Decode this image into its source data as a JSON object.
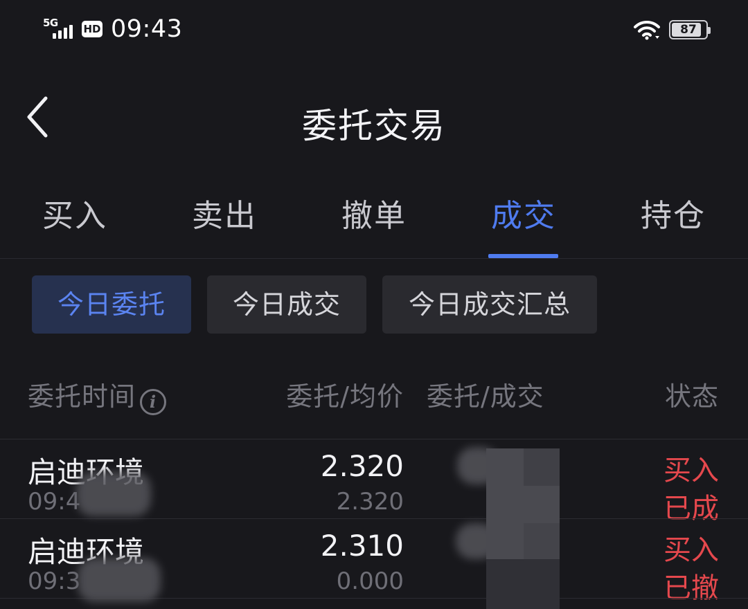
{
  "status_bar": {
    "network": "5G",
    "hd": "HD",
    "time": "09:43",
    "battery": "87",
    "battery_level": 0.87,
    "wifi_icon": "wifi-icon",
    "signal_icon": "signal-icon"
  },
  "header": {
    "title": "委托交易",
    "back_icon": "chevron-left-icon"
  },
  "main_tabs": [
    {
      "label": "买入",
      "active": false
    },
    {
      "label": "卖出",
      "active": false
    },
    {
      "label": "撤单",
      "active": false
    },
    {
      "label": "成交",
      "active": true
    },
    {
      "label": "持仓",
      "active": false
    }
  ],
  "sub_tabs": [
    {
      "label": "今日委托",
      "active": true
    },
    {
      "label": "今日成交",
      "active": false
    },
    {
      "label": "今日成交汇总",
      "active": false
    }
  ],
  "table": {
    "columns": [
      "委托时间",
      "委托/均价",
      "委托/成交",
      "状态"
    ],
    "info_icon": "info-icon",
    "rows": [
      {
        "name": "启迪环境",
        "time": "09:4",
        "price": "2.320",
        "avg_price": "2.320",
        "side": "买入",
        "status": "已成"
      },
      {
        "name": "启迪环境",
        "time": "09:3",
        "price": "2.310",
        "avg_price": "0.000",
        "side": "买入",
        "status": "已撤"
      }
    ]
  },
  "colors": {
    "background": "#18181c",
    "accent": "#4f7bef",
    "buy_red": "#e5484d",
    "muted": "#76767e"
  }
}
